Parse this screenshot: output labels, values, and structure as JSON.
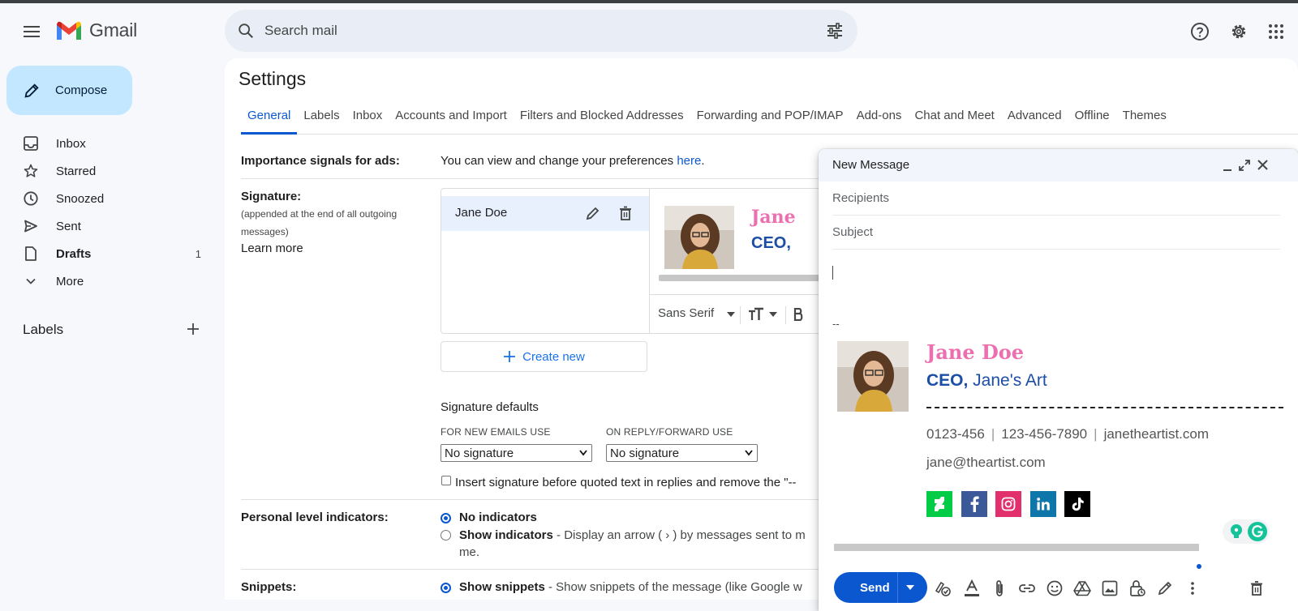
{
  "app": {
    "name": "Gmail"
  },
  "search": {
    "placeholder": "Search mail"
  },
  "compose_button": {
    "label": "Compose"
  },
  "nav": [
    {
      "label": "Inbox",
      "icon": "inbox-icon",
      "count": ""
    },
    {
      "label": "Starred",
      "icon": "star-icon",
      "count": ""
    },
    {
      "label": "Snoozed",
      "icon": "clock-icon",
      "count": ""
    },
    {
      "label": "Sent",
      "icon": "send-icon",
      "count": ""
    },
    {
      "label": "Drafts",
      "icon": "draft-icon",
      "count": "1"
    },
    {
      "label": "More",
      "icon": "chevron-down-icon",
      "count": ""
    }
  ],
  "labels_heading": "Labels",
  "settings": {
    "title": "Settings",
    "tabs": [
      "General",
      "Labels",
      "Inbox",
      "Accounts and Import",
      "Filters and Blocked Addresses",
      "Forwarding and POP/IMAP",
      "Add-ons",
      "Chat and Meet",
      "Advanced",
      "Offline",
      "Themes"
    ],
    "active_tab": "General",
    "importance": {
      "label": "Importance signals for ads:",
      "text": "You can view and change your preferences ",
      "link": "here",
      "suffix": "."
    },
    "signature": {
      "label": "Signature:",
      "sub": "(appended at the end of all outgoing messages)",
      "learn_more": "Learn more",
      "item_name": "Jane Doe",
      "preview_name": "Jane",
      "preview_title": "CEO,",
      "font": "Sans Serif",
      "create_new": "Create new",
      "defaults_title": "Signature defaults",
      "new_label": "FOR NEW EMAILS USE",
      "reply_label": "ON REPLY/FORWARD USE",
      "new_value": "No signature",
      "reply_value": "No signature",
      "insert_text": "Insert signature before quoted text in replies and remove the \"--"
    },
    "personal": {
      "label": "Personal level indicators:",
      "opt1": "No indicators",
      "opt2": "Show indicators",
      "opt2_desc": " - Display an arrow ( › ) by messages sent to m",
      "opt2_cont": "me."
    },
    "snippets": {
      "label": "Snippets:",
      "opt1": "Show snippets",
      "opt1_desc": " - Show snippets of the message (like Google w"
    }
  },
  "compose_window": {
    "title": "New Message",
    "recipients_placeholder": "Recipients",
    "subject_placeholder": "Subject",
    "sig_separator": "--",
    "name": "Jane Doe",
    "role": "CEO,",
    "company": " Jane's Art",
    "phone1": "0123-456",
    "phone2": "123-456-7890",
    "website": "janetheartist.com",
    "email": "jane@theartist.com",
    "send_label": "Send",
    "social": [
      {
        "name": "deviantart",
        "color": "#05cc47",
        "glyph": "✦"
      },
      {
        "name": "facebook",
        "color": "#3b5998",
        "glyph": "f"
      },
      {
        "name": "instagram",
        "color": "#e1306c",
        "glyph": "◎"
      },
      {
        "name": "linkedin",
        "color": "#0e76a8",
        "glyph": "in"
      },
      {
        "name": "tiktok",
        "color": "#000000",
        "glyph": "♪"
      }
    ]
  },
  "colors": {
    "accent": "#0b57d0",
    "compose_bg": "#c2e7ff",
    "page_bg": "#f6f8fc",
    "sig_pink": "#ec6fb0",
    "sig_blue": "#1c4ea6"
  }
}
